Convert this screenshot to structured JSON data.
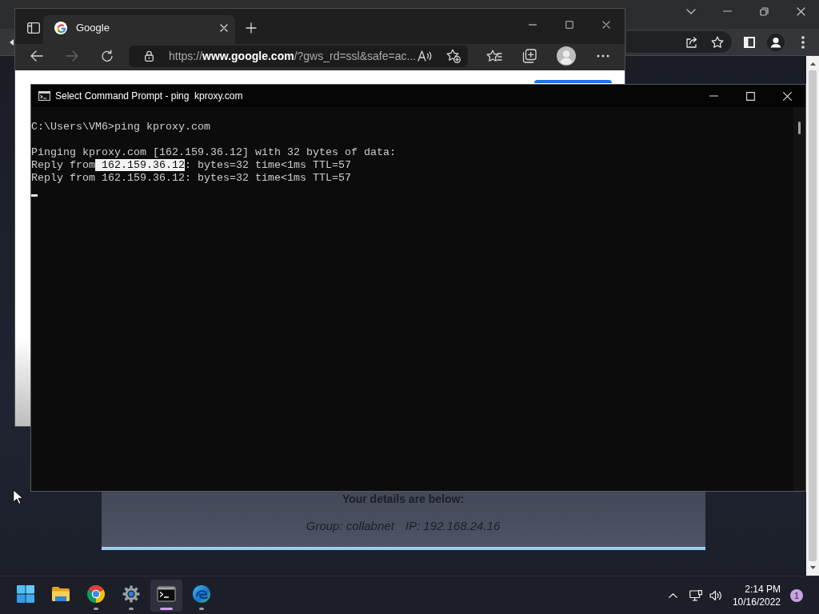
{
  "background_browser": {
    "page": {
      "card": {
        "heading": "Your details are below:",
        "group": "Group: collabnet",
        "ip": "IP: 192.168.24.16"
      }
    }
  },
  "browser": {
    "tabs": [
      {
        "title": "Google",
        "selected": true
      }
    ],
    "navigation": {
      "back": {
        "disabled": false
      },
      "forward": {
        "disabled": true
      }
    },
    "address_bar": {
      "url": "https://**www.google.com**/?gws_rd=ssl&safe=ac..."
    }
  },
  "console": {
    "title": "Select Command Prompt - ping  kproxy.com",
    "blocks": [
      {
        "lines": [
          {
            "segments": [
              {
                "text": "C:\\Users\\VM6>ping kproxy.com",
                "selected": false
              }
            ]
          }
        ]
      },
      {
        "lines": [
          {
            "segments": [
              {
                "text": "Pinging kproxy.com [162.159.36.12] with 32 bytes of data:",
                "selected": false
              }
            ]
          },
          {
            "segments": [
              {
                "text": "Reply from",
                "selected": false
              },
              {
                "text": " 162.159.36.12",
                "selected": true
              },
              {
                "text": ": bytes=32 time<1ms TTL=57",
                "selected": false
              }
            ]
          },
          {
            "segments": [
              {
                "text": "Reply from 162.159.36.12: bytes=32 time<1ms TTL=57",
                "selected": false
              }
            ]
          }
        ]
      }
    ],
    "cursor_visible": true
  },
  "taskbar": {
    "apps": [
      {
        "kind": "start",
        "running": false,
        "selected": false
      },
      {
        "kind": "explorer",
        "running": false,
        "selected": false
      },
      {
        "kind": "chrome",
        "running": true,
        "selected": false
      },
      {
        "kind": "settings",
        "running": true,
        "selected": false
      },
      {
        "kind": "terminal",
        "running": true,
        "selected": true
      },
      {
        "kind": "edge",
        "running": true,
        "selected": false
      }
    ],
    "clock": {
      "time": "2:14 PM",
      "date": "10/16/2022"
    },
    "notifications": {
      "count": "1"
    }
  }
}
